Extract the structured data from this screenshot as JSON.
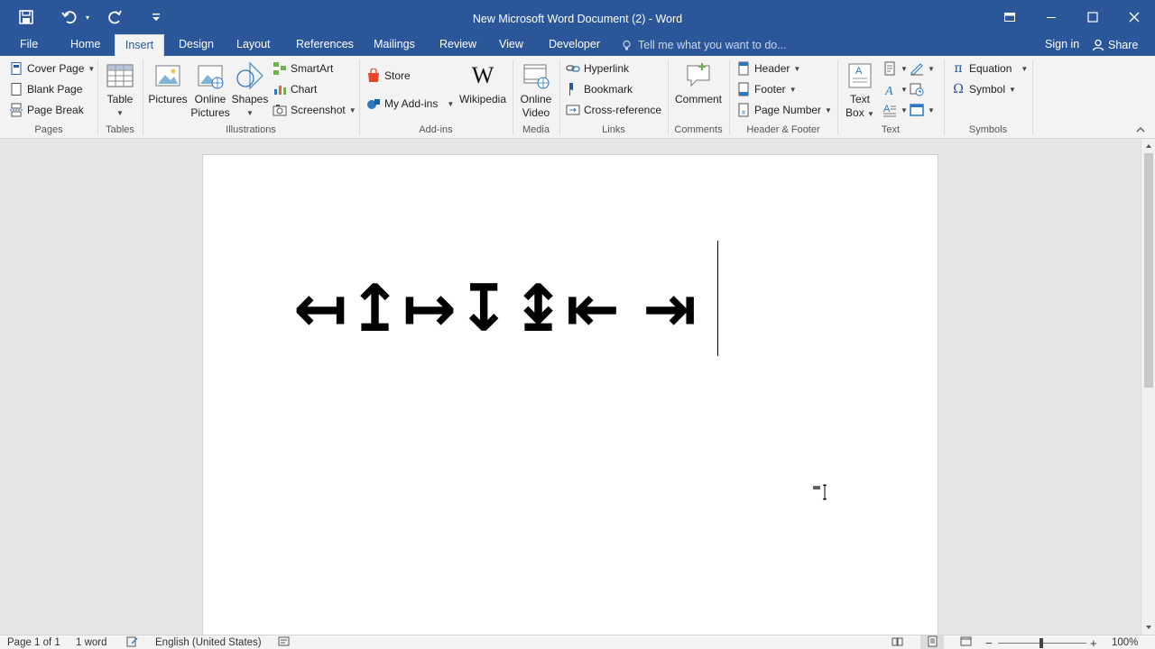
{
  "window": {
    "title": "New Microsoft Word Document (2) - Word"
  },
  "quick_access": {
    "icons": [
      "save-icon",
      "undo-icon",
      "redo-icon",
      "customize-qat-icon"
    ]
  },
  "tabs": [
    {
      "label": "File"
    },
    {
      "label": "Home"
    },
    {
      "label": "Insert",
      "active": true
    },
    {
      "label": "Design"
    },
    {
      "label": "Layout"
    },
    {
      "label": "References"
    },
    {
      "label": "Mailings"
    },
    {
      "label": "Review"
    },
    {
      "label": "View"
    },
    {
      "label": "Developer"
    }
  ],
  "tell_me": {
    "placeholder": "Tell me what you want to do..."
  },
  "account": {
    "signin": "Sign in",
    "share": "Share"
  },
  "ribbon": {
    "pages": {
      "label": "Pages",
      "cover_page": "Cover Page",
      "blank_page": "Blank Page",
      "page_break": "Page Break"
    },
    "tables": {
      "label": "Tables",
      "table": "Table"
    },
    "illustrations": {
      "label": "Illustrations",
      "pictures": "Pictures",
      "online_pictures_1": "Online",
      "online_pictures_2": "Pictures",
      "shapes": "Shapes",
      "smartart": "SmartArt",
      "chart": "Chart",
      "screenshot": "Screenshot"
    },
    "addins": {
      "label": "Add-ins",
      "store": "Store",
      "my_addins": "My Add-ins",
      "wikipedia": "Wikipedia"
    },
    "media": {
      "label": "Media",
      "online_video_1": "Online",
      "online_video_2": "Video"
    },
    "links": {
      "label": "Links",
      "hyperlink": "Hyperlink",
      "bookmark": "Bookmark",
      "cross_reference": "Cross-reference"
    },
    "comments": {
      "label": "Comments",
      "comment": "Comment"
    },
    "header_footer": {
      "label": "Header & Footer",
      "header": "Header",
      "footer": "Footer",
      "page_number": "Page Number"
    },
    "text": {
      "label": "Text",
      "text_box_1": "Text",
      "text_box_2": "Box"
    },
    "symbols": {
      "label": "Symbols",
      "equation": "Equation",
      "symbol": "Symbol"
    }
  },
  "document": {
    "content": "↤↥↦↧↨⇤ ⇥"
  },
  "status": {
    "page": "Page 1 of 1",
    "words": "1 word",
    "language": "English (United States)",
    "zoom": "100%"
  },
  "colors": {
    "title_bar": "#2b579a",
    "ribbon_bg": "#f3f3f3",
    "document_bg": "#e6e6e6"
  }
}
